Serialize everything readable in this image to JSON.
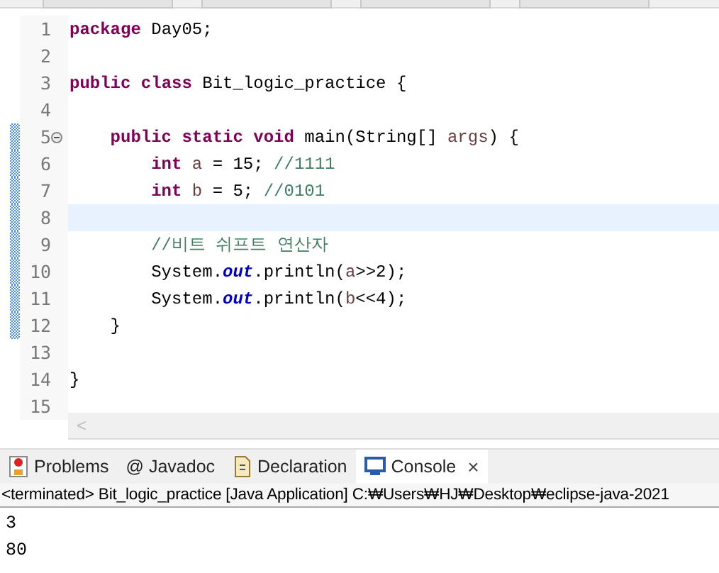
{
  "editor_tabs": [
    {
      "selected": false
    },
    {
      "selected": false
    },
    {
      "selected": false
    },
    {
      "selected": false
    }
  ],
  "code_lines": [
    {
      "number": "1",
      "changed": false,
      "current": false,
      "fold": false,
      "tokens": [
        {
          "kind": "keyword",
          "text": "package"
        },
        {
          "kind": "plain",
          "text": " Day05;"
        }
      ]
    },
    {
      "number": "2",
      "changed": false,
      "current": false,
      "fold": false
    },
    {
      "number": "3",
      "changed": false,
      "current": false,
      "fold": false,
      "tokens": [
        {
          "kind": "keyword",
          "text": "public"
        },
        {
          "kind": "keyword",
          "text": " class"
        },
        {
          "kind": "plain",
          "text": " Bit_logic_practice {"
        }
      ]
    },
    {
      "number": "4",
      "changed": false,
      "current": false,
      "fold": false
    },
    {
      "number": "5",
      "changed": true,
      "current": false,
      "fold": true,
      "tokens": [
        {
          "kind": "keyword",
          "text": "    public"
        },
        {
          "kind": "keyword",
          "text": " static"
        },
        {
          "kind": "keyword",
          "text": " void"
        },
        {
          "kind": "plain",
          "text": " main(String[]"
        },
        {
          "kind": "variable",
          "text": " args"
        },
        {
          "kind": "plain",
          "text": ") {"
        }
      ]
    },
    {
      "number": "6",
      "changed": true,
      "current": false,
      "fold": false,
      "tokens": [
        {
          "kind": "keyword",
          "text": "        int"
        },
        {
          "kind": "variable",
          "text": " a"
        },
        {
          "kind": "plain",
          "text": " = 15;"
        },
        {
          "kind": "comment",
          "text": " //1111"
        }
      ]
    },
    {
      "number": "7",
      "changed": true,
      "current": false,
      "fold": false,
      "tokens": [
        {
          "kind": "keyword",
          "text": "        int"
        },
        {
          "kind": "variable",
          "text": " b"
        },
        {
          "kind": "plain",
          "text": " = 5;"
        },
        {
          "kind": "comment",
          "text": " //0101"
        }
      ]
    },
    {
      "number": "8",
      "changed": true,
      "current": true,
      "fold": false
    },
    {
      "number": "9",
      "changed": true,
      "current": false,
      "fold": false,
      "tokens": [
        {
          "kind": "comment",
          "text": "        //비트 쉬프트 연산자"
        }
      ]
    },
    {
      "number": "10",
      "changed": true,
      "current": false,
      "fold": false,
      "tokens": [
        {
          "kind": "plain",
          "text": "        System."
        },
        {
          "kind": "field",
          "text": "out"
        },
        {
          "kind": "plain",
          "text": ".println("
        },
        {
          "kind": "variable",
          "text": "a"
        },
        {
          "kind": "plain",
          "text": ">>2);"
        }
      ]
    },
    {
      "number": "11",
      "changed": true,
      "current": false,
      "fold": false,
      "tokens": [
        {
          "kind": "plain",
          "text": "        System."
        },
        {
          "kind": "field",
          "text": "out"
        },
        {
          "kind": "plain",
          "text": ".println("
        },
        {
          "kind": "variable",
          "text": "b"
        },
        {
          "kind": "plain",
          "text": "<<4);"
        }
      ]
    },
    {
      "number": "12",
      "changed": true,
      "current": false,
      "fold": false,
      "tokens": [
        {
          "kind": "plain",
          "text": "    }"
        }
      ]
    },
    {
      "number": "13",
      "changed": false,
      "current": false,
      "fold": false
    },
    {
      "number": "14",
      "changed": false,
      "current": false,
      "fold": false,
      "tokens": [
        {
          "kind": "plain",
          "text": "}"
        }
      ]
    },
    {
      "number": "15",
      "changed": false,
      "current": false,
      "fold": false
    }
  ],
  "scroll_left": "<",
  "view_tabs": [
    {
      "kind": "problems",
      "label": "Problems",
      "selected": false
    },
    {
      "kind": "javadoc",
      "label": "@ Javadoc",
      "selected": false
    },
    {
      "kind": "declaration",
      "label": "Declaration",
      "selected": false
    },
    {
      "kind": "console",
      "label": "Console",
      "selected": true,
      "close": "×"
    }
  ],
  "console": {
    "header": "<terminated> Bit_logic_practice [Java Application] C:₩Users₩HJ₩Desktop₩eclipse-java-2021",
    "output": [
      "3",
      "80"
    ]
  }
}
